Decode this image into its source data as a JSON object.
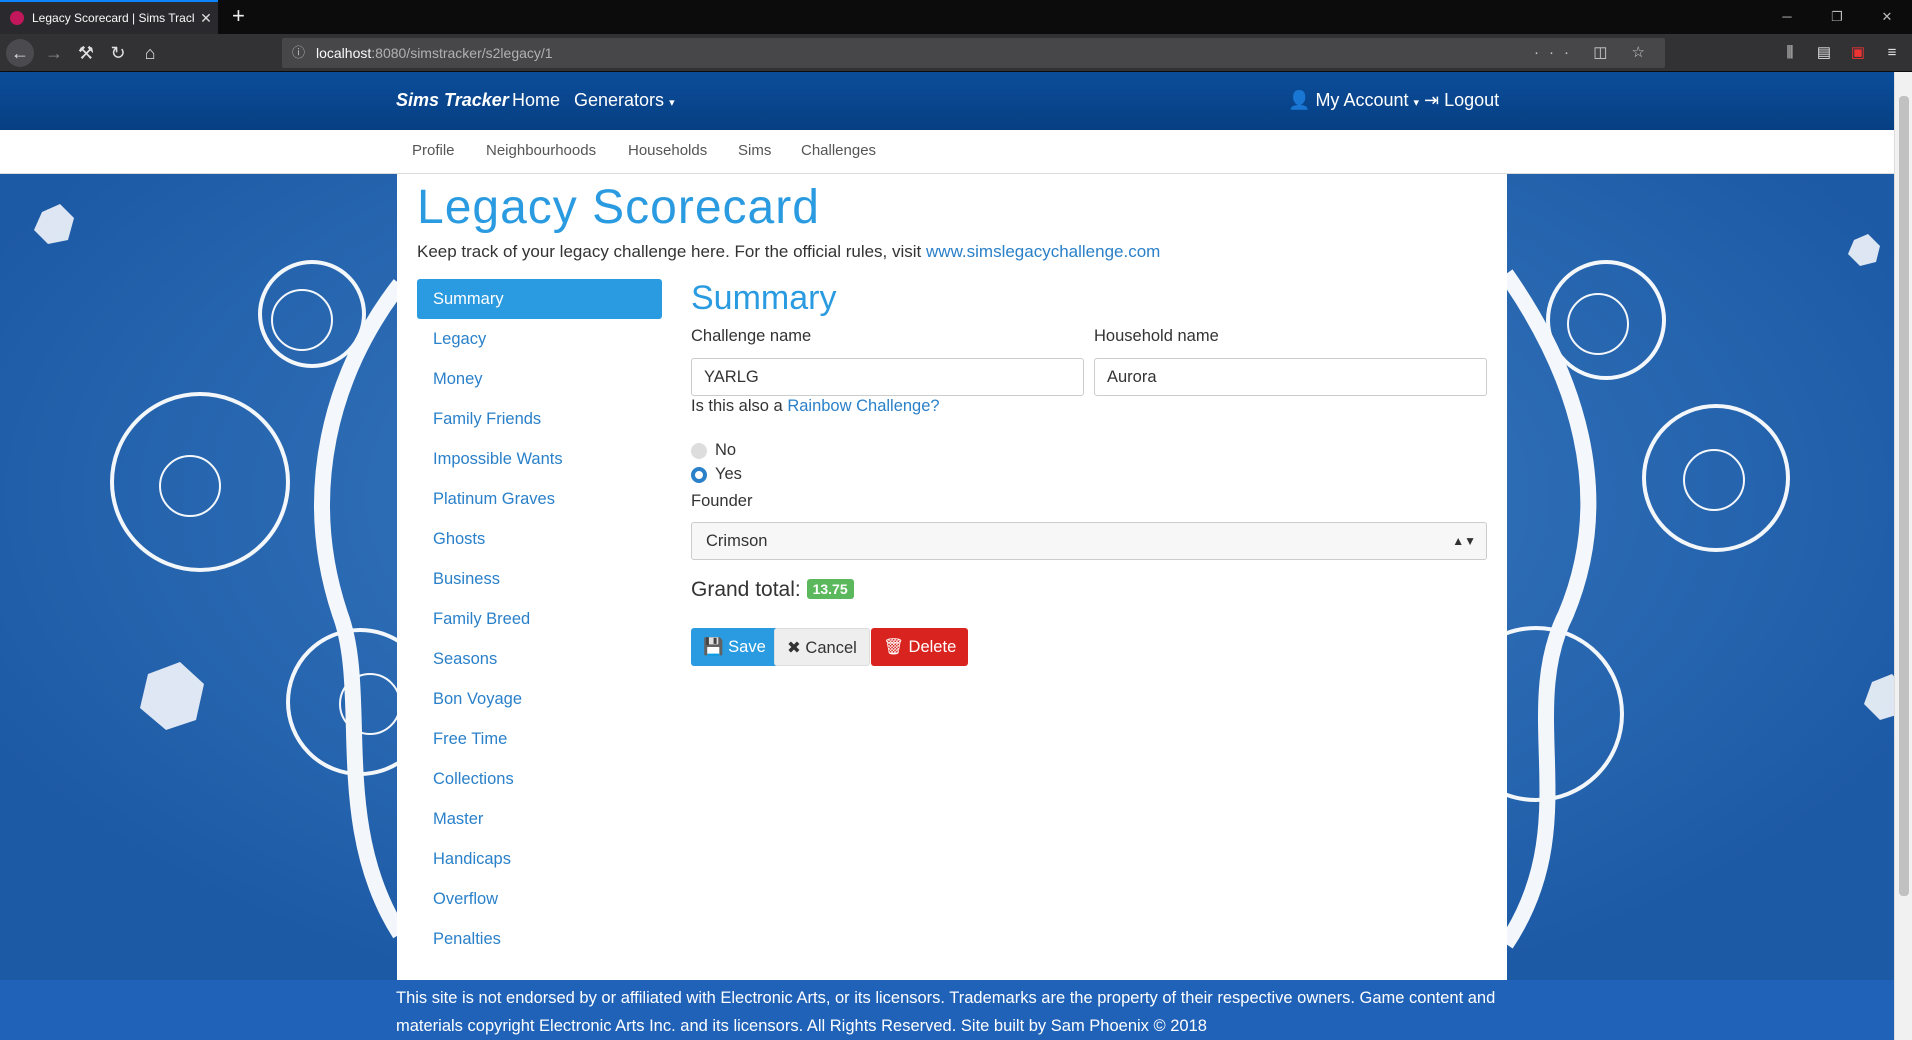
{
  "browser": {
    "tab_title": "Legacy Scorecard | Sims Tracke",
    "url_host": "localhost",
    "url_path": ":8080/simstracker/s2legacy/1"
  },
  "site_nav": {
    "brand": "Sims Tracker",
    "home": "Home",
    "generators": "Generators",
    "my_account": "My Account",
    "logout": "Logout"
  },
  "sub_nav": [
    "Profile",
    "Neighbourhoods",
    "Households",
    "Sims",
    "Challenges"
  ],
  "page": {
    "title": "Legacy Scorecard",
    "intro_text": "Keep track of your legacy challenge here. For the official rules, visit",
    "intro_link": "www.simslegacychallenge.com"
  },
  "sidebar": {
    "active": "Summary",
    "items": [
      "Summary",
      "Legacy",
      "Money",
      "Family Friends",
      "Impossible Wants",
      "Platinum Graves",
      "Ghosts",
      "Business",
      "Family Breed",
      "Seasons",
      "Bon Voyage",
      "Free Time",
      "Collections",
      "Master",
      "Handicaps",
      "Overflow",
      "Penalties"
    ]
  },
  "summary": {
    "heading": "Summary",
    "challenge_name_label": "Challenge name",
    "challenge_name_value": "YARLG",
    "household_name_label": "Household name",
    "household_name_value": "Aurora",
    "rainbow_prefix": "Is this also a",
    "rainbow_link": "Rainbow Challenge?",
    "rainbow_options": [
      "No",
      "Yes"
    ],
    "rainbow_selected": "Yes",
    "founder_label": "Founder",
    "founder_value": "Crimson",
    "grand_total_label": "Grand total:",
    "grand_total_value": "13.75"
  },
  "buttons": {
    "save": "Save",
    "cancel": "Cancel",
    "delete": "Delete"
  },
  "footer": {
    "text": "This site is not endorsed by or affiliated with Electronic Arts, or its licensors. Trademarks are the property of their respective owners. Game content and materials copyright Electronic Arts Inc. and its licensors. All Rights Reserved. Site built by Sam Phoenix © 2018"
  },
  "colors": {
    "accent": "#2a9be0",
    "navbar": "#0b4d9a",
    "footer": "#1f62b8",
    "badge": "#5cb85c",
    "delete": "#d9231e"
  }
}
